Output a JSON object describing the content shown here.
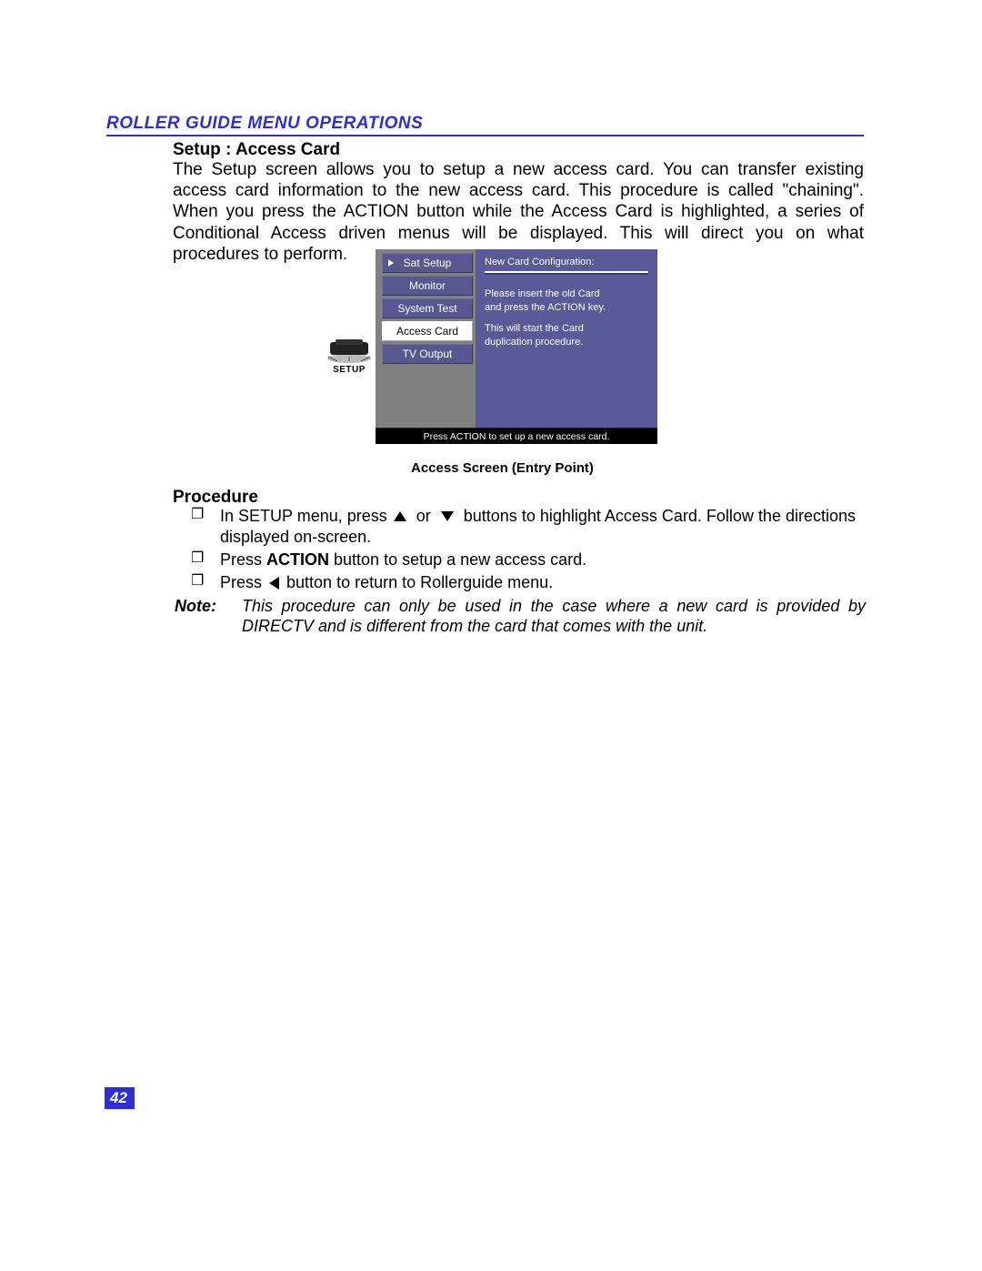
{
  "header": "ROLLER GUIDE MENU OPERATIONS",
  "subheading": "Setup : Access Card",
  "intro": "The Setup screen allows you to setup a new access card. You can transfer existing access card information to the new access card. This procedure is called \"chaining\". When you press the ACTION button while the Access Card is highlighted, a series of Conditional Access driven menus will be displayed. This will direct you on what procedures to perform.",
  "osd": {
    "menu": {
      "items": [
        "Sat Setup",
        "Monitor",
        "System Test",
        "Access Card",
        "TV Output"
      ],
      "selected_index": 3,
      "arrow_index": 0
    },
    "panel": {
      "title": "New Card Configuration:",
      "line1": "Please insert the old Card",
      "line2": "and press the ACTION key.",
      "line3": "This will start the Card",
      "line4": "duplication procedure."
    },
    "footer": "Press ACTION to set up a new access card."
  },
  "icon_label": "SETUP",
  "caption": "Access Screen (Entry Point)",
  "procedure_heading": "Procedure",
  "proc": {
    "b1_pre": "In SETUP menu, press ",
    "b1_mid": " or ",
    "b1_post": " buttons to highlight Access Card. Follow the directions displayed on-screen.",
    "b2_a": "Press ",
    "b2_b": "ACTION",
    "b2_c": " button to setup a new access card.",
    "b3_a": "Press ",
    "b3_b": " button to return to Rollerguide menu."
  },
  "note": {
    "label": "Note:",
    "text": "This procedure can only be used in the case where a new card is provided by DIRECTV and is different from the card that comes with the unit."
  },
  "page_number": "42"
}
